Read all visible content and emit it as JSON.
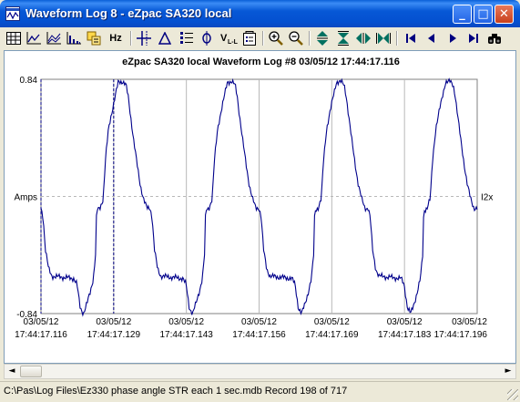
{
  "window": {
    "title": "Waveform Log 8 - eZpac SA320 local",
    "controls": {
      "minimize": "_",
      "maximize": "□",
      "close": "✕"
    }
  },
  "toolbar": {
    "hz_label": "Hz",
    "icons": [
      "table-icon",
      "line-chart-icon",
      "multi-line-chart-icon",
      "bar-chart-icon",
      "harmonics-icon",
      "hz-icon",
      "cursor-icon",
      "delta-icon",
      "list-icon",
      "probe-icon",
      "vll-icon",
      "properties-icon",
      "zoom-in-icon",
      "zoom-out-icon",
      "expand-vertical-icon",
      "collapse-vertical-icon",
      "expand-horizontal-icon",
      "collapse-horizontal-icon",
      "first-record-icon",
      "previous-record-icon",
      "next-record-icon",
      "last-record-icon",
      "find-icon"
    ]
  },
  "chart": {
    "title": "eZpac SA320 local  Waveform Log #8   03/05/12  17:44:17.116"
  },
  "chart_data": {
    "type": "line",
    "title": "eZpac SA320 local  Waveform Log #8   03/05/12  17:44:17.116",
    "ylabel": "Amps",
    "ylim": [
      -0.84,
      0.84
    ],
    "yticks": [
      "0.84",
      "Amps",
      "-0.84"
    ],
    "x_ticks": [
      {
        "date": "03/05/12",
        "time": "17:44:17.116"
      },
      {
        "date": "03/05/12",
        "time": "17:44:17.129"
      },
      {
        "date": "03/05/12",
        "time": "17:44:17.143"
      },
      {
        "date": "03/05/12",
        "time": "17:44:17.156"
      },
      {
        "date": "03/05/12",
        "time": "17:44:17.169"
      },
      {
        "date": "03/05/12",
        "time": "17:44:17.183"
      },
      {
        "date": "03/05/12",
        "time": "17:44:17.196"
      }
    ],
    "cursor_times": [
      "17:44:17.116",
      "17:44:17.129"
    ],
    "grid": true,
    "line_color": "#00008b",
    "series": [
      {
        "name": "I2x",
        "cycles": 4,
        "cycle_shape_pct": [
          [
            0,
            -70
          ],
          [
            3,
            -75
          ],
          [
            6,
            -95
          ],
          [
            9,
            -100
          ],
          [
            12,
            -92
          ],
          [
            15,
            -82
          ],
          [
            18,
            -70
          ],
          [
            20,
            -50
          ],
          [
            21,
            -12
          ],
          [
            24,
            -10
          ],
          [
            27,
            -2
          ],
          [
            29,
            30
          ],
          [
            32,
            58
          ],
          [
            35,
            72
          ],
          [
            38,
            85
          ],
          [
            41,
            98
          ],
          [
            45,
            98
          ],
          [
            48,
            95
          ],
          [
            50,
            85
          ],
          [
            52,
            70
          ],
          [
            55,
            48
          ],
          [
            58,
            28
          ],
          [
            61,
            10
          ],
          [
            64,
            -2
          ],
          [
            67,
            -10
          ],
          [
            70,
            -10
          ],
          [
            72,
            -18
          ],
          [
            74,
            -45
          ],
          [
            77,
            -62
          ],
          [
            80,
            -68
          ],
          [
            100,
            -70
          ]
        ],
        "start_phase_pct": 70
      }
    ]
  },
  "scrollbar": {
    "left_arrow": "◄",
    "right_arrow": "►"
  },
  "status": {
    "text": "C:\\Pas\\Log Files\\Ez330 phase angle STR each 1 sec.mdb  Record 198 of 717"
  }
}
